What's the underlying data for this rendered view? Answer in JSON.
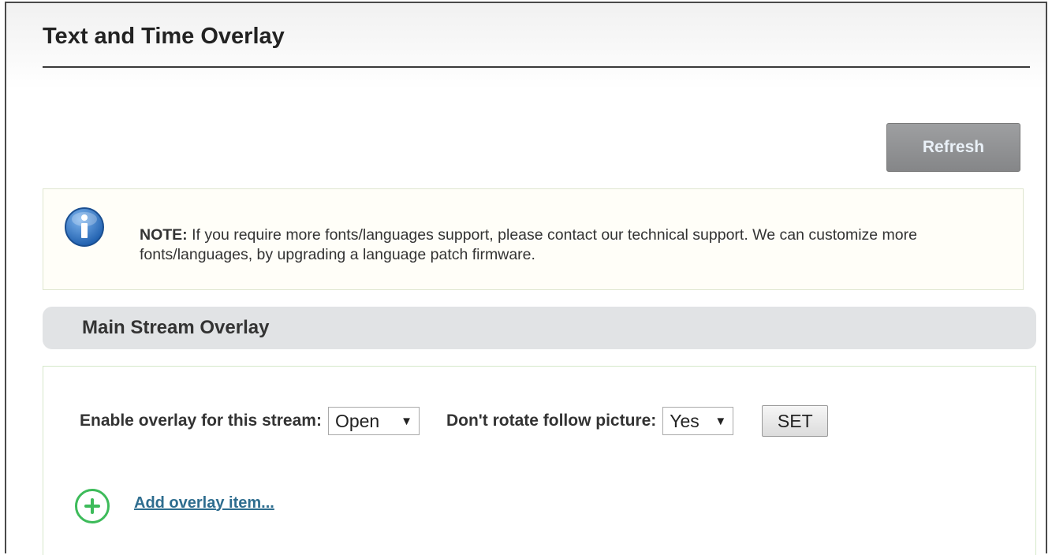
{
  "page": {
    "title": "Text and Time Overlay"
  },
  "toolbar": {
    "refresh_label": "Refresh"
  },
  "note": {
    "label": "NOTE:",
    "text": " If you require more fonts/languages support, please contact our technical support. We can customize more fonts/languages, by upgrading a language patch firmware.",
    "icon": "info-icon"
  },
  "main_stream": {
    "title": "Main Stream Overlay",
    "enable_label": "Enable overlay for this stream:",
    "enable_value": "Open",
    "rotate_label": "Don't rotate follow picture:",
    "rotate_value": "Yes",
    "set_label": "SET",
    "add_item_label": "Add overlay item...",
    "add_icon": "plus-circle-icon"
  },
  "colors": {
    "refresh_button": "#8f9092",
    "section_header": "#e1e3e5",
    "add_icon": "#3dbb5a",
    "link": "#2e6d8f",
    "info_icon": "#2b78c8"
  }
}
